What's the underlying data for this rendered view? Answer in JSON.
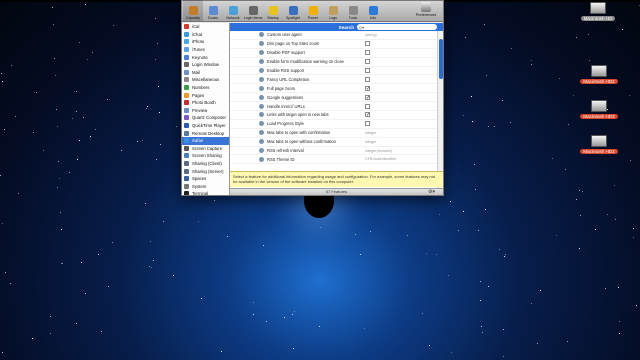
{
  "colors": {
    "selection": "#3875d7",
    "header": "#2b6fdc",
    "description_bg": "#fff8b0"
  },
  "toolbar": {
    "items": [
      {
        "label": "Capacity",
        "icon": "capacity-icon",
        "color": "#c47b2a"
      },
      {
        "label": "Docks",
        "icon": "docks-icon",
        "color": "#5b8ad6"
      },
      {
        "label": "Network",
        "icon": "network-icon",
        "color": "#4aa0d8"
      },
      {
        "label": "Login Items",
        "icon": "login-items-icon",
        "color": "#666666"
      },
      {
        "label": "Startup",
        "icon": "startup-icon",
        "color": "#e8c31c"
      },
      {
        "label": "Spotlight",
        "icon": "spotlight-icon",
        "color": "#3a6fc0"
      },
      {
        "label": "Power",
        "icon": "power-icon",
        "color": "#f0b000"
      },
      {
        "label": "Logs",
        "icon": "logs-icon",
        "color": "#c0a060"
      },
      {
        "label": "Tools",
        "icon": "tools-icon",
        "color": "#888888"
      },
      {
        "label": "Info",
        "icon": "info-icon",
        "color": "#2b7ad8"
      }
    ],
    "preferences_label": "Preferences"
  },
  "sidebar": {
    "items": [
      {
        "label": "iCal",
        "color": "#d23a2a"
      },
      {
        "label": "iChat",
        "color": "#3b9ad8"
      },
      {
        "label": "iPhoto",
        "color": "#4aa8e0"
      },
      {
        "label": "iTunes",
        "color": "#5aa0e8"
      },
      {
        "label": "Keynote",
        "color": "#4b7fd6"
      },
      {
        "label": "Login Window",
        "color": "#666666"
      },
      {
        "label": "Mail",
        "color": "#6b90c8"
      },
      {
        "label": "Miscellaneous",
        "color": "#888888"
      },
      {
        "label": "Numbers",
        "color": "#3ca04a"
      },
      {
        "label": "Pages",
        "color": "#e89a2a"
      },
      {
        "label": "Photo Booth",
        "color": "#c03030"
      },
      {
        "label": "Preview",
        "color": "#6a8ac0"
      },
      {
        "label": "Quartz Composer",
        "color": "#7a5ac0"
      },
      {
        "label": "QuickTime Player",
        "color": "#2a5ab0"
      },
      {
        "label": "Remote Desktop",
        "color": "#5a7a9a"
      },
      {
        "label": "Safari",
        "color": "#3a90e0"
      },
      {
        "label": "Screen Capture",
        "color": "#555555"
      },
      {
        "label": "Screen Sharing",
        "color": "#4a80c0"
      },
      {
        "label": "Sharing (Client)",
        "color": "#5a6a8a"
      },
      {
        "label": "Sharing (Server)",
        "color": "#5a6a8a"
      },
      {
        "label": "Spaces",
        "color": "#3a60a0"
      },
      {
        "label": "System",
        "color": "#777777"
      },
      {
        "label": "Terminal",
        "color": "#222222"
      }
    ],
    "selected_index": 15
  },
  "main": {
    "header_label": "Search",
    "search_placeholder": "Q▾",
    "settings": [
      {
        "label": "Custom user agent",
        "type": "text",
        "value": "(string)"
      },
      {
        "label": "Dim page on Top Sites zoom",
        "type": "checkbox",
        "checked": false
      },
      {
        "label": "Disable PDF support",
        "type": "checkbox",
        "checked": false
      },
      {
        "label": "Enable form modification warning on close",
        "type": "checkbox",
        "checked": false
      },
      {
        "label": "Enable RSS support",
        "type": "checkbox",
        "checked": false
      },
      {
        "label": "Fancy URL Completion",
        "type": "checkbox",
        "checked": false
      },
      {
        "label": "Full page zoom",
        "type": "checkbox",
        "checked": true
      },
      {
        "label": "Google suggestions",
        "type": "checkbox",
        "checked": true
      },
      {
        "label": "Handle mms:// URLs",
        "type": "checkbox",
        "checked": false
      },
      {
        "label": "Links with target open in new tabs",
        "type": "checkbox",
        "checked": true
      },
      {
        "label": "Load Progress Style",
        "type": "checkbox",
        "checked": false
      },
      {
        "label": "Max tabs to open with confirmation",
        "type": "text",
        "value": "integer"
      },
      {
        "label": "Max tabs to open without confirmation",
        "type": "text",
        "value": "integer"
      },
      {
        "label": "RSS refresh interval",
        "type": "text",
        "value": "integer(minutes)"
      },
      {
        "label": "RSS Theme ID",
        "type": "text",
        "value": "CFBundleIdentifier"
      },
      {
        "label": "",
        "type": "text",
        "value": ""
      },
      {
        "label": "",
        "type": "text",
        "value": ""
      },
      {
        "label": "",
        "type": "text",
        "value": ""
      }
    ]
  },
  "description": "Select a feature for additional information regarding usage and configuration. For example, some features may not be available in the version of the software installed on this computer.",
  "status": {
    "count_label": "57 Features",
    "gear": "⚙▾"
  },
  "desktop": {
    "drives": [
      {
        "label": "Macintosh HD",
        "style": "hl2"
      },
      {
        "label": "Macintosh HD2",
        "style": "hl"
      },
      {
        "label": "Macintosh HD3",
        "style": "hl"
      },
      {
        "label": "Macintosh HD3",
        "style": "hl"
      }
    ]
  }
}
